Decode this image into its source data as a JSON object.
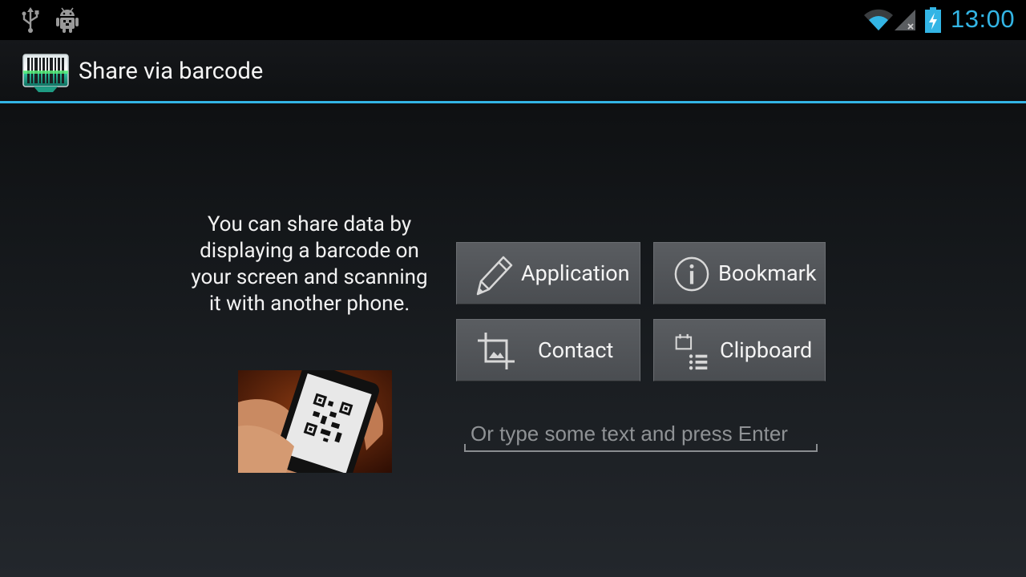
{
  "status_bar": {
    "time": "13:00",
    "icons": [
      "usb-icon",
      "android-debug-icon",
      "wifi-icon",
      "signal-icon",
      "battery-charging-icon"
    ],
    "accent_color": "#33b5e5"
  },
  "action_bar": {
    "title": "Share via barcode",
    "icon": "barcode-scanner-icon",
    "divider_color": "#33b5e5"
  },
  "content": {
    "intro_text": "You can share data by displaying a barcode on your screen and scanning it with another phone.",
    "photo_icon": "phone-showing-qr-code-photo",
    "buttons": [
      {
        "label": "Application",
        "icon": "pencil-icon"
      },
      {
        "label": "Bookmark",
        "icon": "info-icon"
      },
      {
        "label": "Contact",
        "icon": "crop-icon"
      },
      {
        "label": "Clipboard",
        "icon": "clipboard-list-icon"
      }
    ],
    "text_input": {
      "value": "",
      "placeholder": "Or type some text and press Enter"
    }
  }
}
